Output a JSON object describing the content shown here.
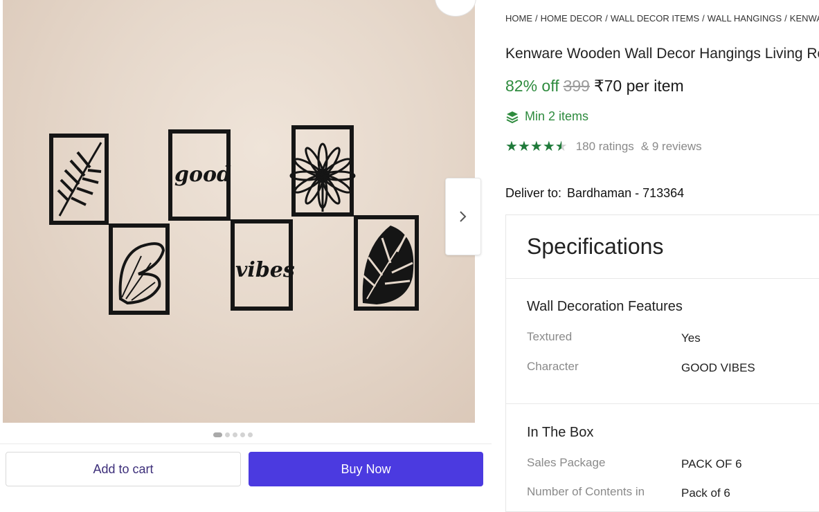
{
  "gallery": {
    "image_alt": "Wall decor hangings on wall",
    "image_words": [
      "good",
      "vibes"
    ],
    "dots_count": 5,
    "active_dot": 0,
    "next_icon": "chevron-right-icon"
  },
  "actions": {
    "add_to_cart_label": "Add to cart",
    "buy_now_label": "Buy Now"
  },
  "breadcrumb": [
    "HOME",
    "HOME DECOR",
    "WALL DECOR ITEMS",
    "WALL HANGINGS",
    "KENWARE"
  ],
  "product": {
    "title": "Kenware Wooden Wall Decor Hangings Living Ro",
    "discount": "82% off",
    "mrp": "399",
    "price": "₹70 per item",
    "min_items_icon": "layers-icon",
    "min_items": "Min 2 items",
    "rating_value": 4.5,
    "ratings_text": "180 ratings",
    "reviews_text": "& 9 reviews"
  },
  "delivery": {
    "label": "Deliver to:",
    "location": "Bardhaman - 713364"
  },
  "specifications": {
    "title": "Specifications",
    "groups": [
      {
        "title": "Wall Decoration Features",
        "rows": [
          {
            "key": "Textured",
            "value": "Yes"
          },
          {
            "key": "Character",
            "value": "GOOD VIBES"
          }
        ]
      },
      {
        "title": "In The Box",
        "rows": [
          {
            "key": "Sales Package",
            "value": "PACK OF 6"
          },
          {
            "key": "Number of Contents in",
            "value": "Pack of 6"
          }
        ]
      }
    ]
  },
  "colors": {
    "accent_green": "#2e8b3e",
    "buy_button": "#4b3ae0",
    "star_green": "#1f7a3a"
  }
}
